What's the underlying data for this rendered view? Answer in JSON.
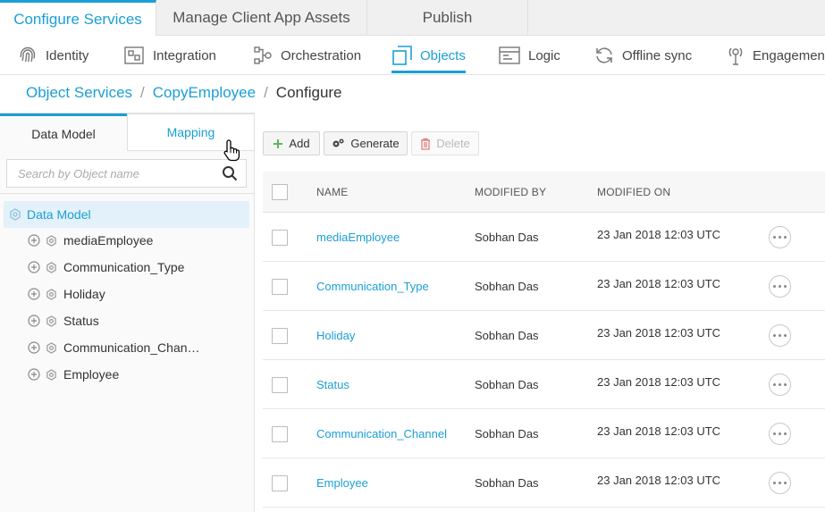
{
  "top_tabs": [
    {
      "label": "Configure Services",
      "active": true
    },
    {
      "label": "Manage Client App Assets",
      "active": false
    },
    {
      "label": "Publish",
      "active": false
    }
  ],
  "subnav": [
    {
      "label": "Identity",
      "icon": "fingerprint-icon"
    },
    {
      "label": "Integration",
      "icon": "puzzle-icon"
    },
    {
      "label": "Orchestration",
      "icon": "flow-icon"
    },
    {
      "label": "Objects",
      "icon": "objects-icon",
      "active": true
    },
    {
      "label": "Logic",
      "icon": "logic-icon"
    },
    {
      "label": "Offline sync",
      "icon": "sync-icon"
    },
    {
      "label": "Engagement",
      "icon": "engagement-icon"
    }
  ],
  "breadcrumb": {
    "items": [
      "Object Services",
      "CopyEmployee"
    ],
    "current": "Configure",
    "separator": "/"
  },
  "left_panel": {
    "tabs": [
      "Data Model",
      "Mapping"
    ],
    "search_placeholder": "Search by Object name",
    "tree_root": "Data Model",
    "tree_items": [
      "mediaEmployee",
      "Communication_Type",
      "Holiday",
      "Status",
      "Communication_Chan…",
      "Employee"
    ]
  },
  "toolbar": {
    "add_label": "Add",
    "generate_label": "Generate",
    "delete_label": "Delete"
  },
  "table": {
    "headers": {
      "name": "NAME",
      "modified_by": "MODIFIED BY",
      "modified_on": "MODIFIED ON"
    },
    "rows": [
      {
        "name": "mediaEmployee",
        "modified_by": "Sobhan Das",
        "modified_on": "23 Jan 2018 12:03 UTC"
      },
      {
        "name": "Communication_Type",
        "modified_by": "Sobhan Das",
        "modified_on": "23 Jan 2018 12:03 UTC"
      },
      {
        "name": "Holiday",
        "modified_by": "Sobhan Das",
        "modified_on": "23 Jan 2018 12:03 UTC"
      },
      {
        "name": "Status",
        "modified_by": "Sobhan Das",
        "modified_on": "23 Jan 2018 12:03 UTC"
      },
      {
        "name": "Communication_Channel",
        "modified_by": "Sobhan Das",
        "modified_on": "23 Jan 2018 12:03 UTC"
      },
      {
        "name": "Employee",
        "modified_by": "Sobhan Das",
        "modified_on": "23 Jan 2018 12:03 UTC"
      }
    ]
  },
  "colors": {
    "accent": "#1a9fd6",
    "tree_selected_bg": "#e3f1fb",
    "add_icon": "#5cb85c",
    "delete_icon": "#e07a7a"
  }
}
